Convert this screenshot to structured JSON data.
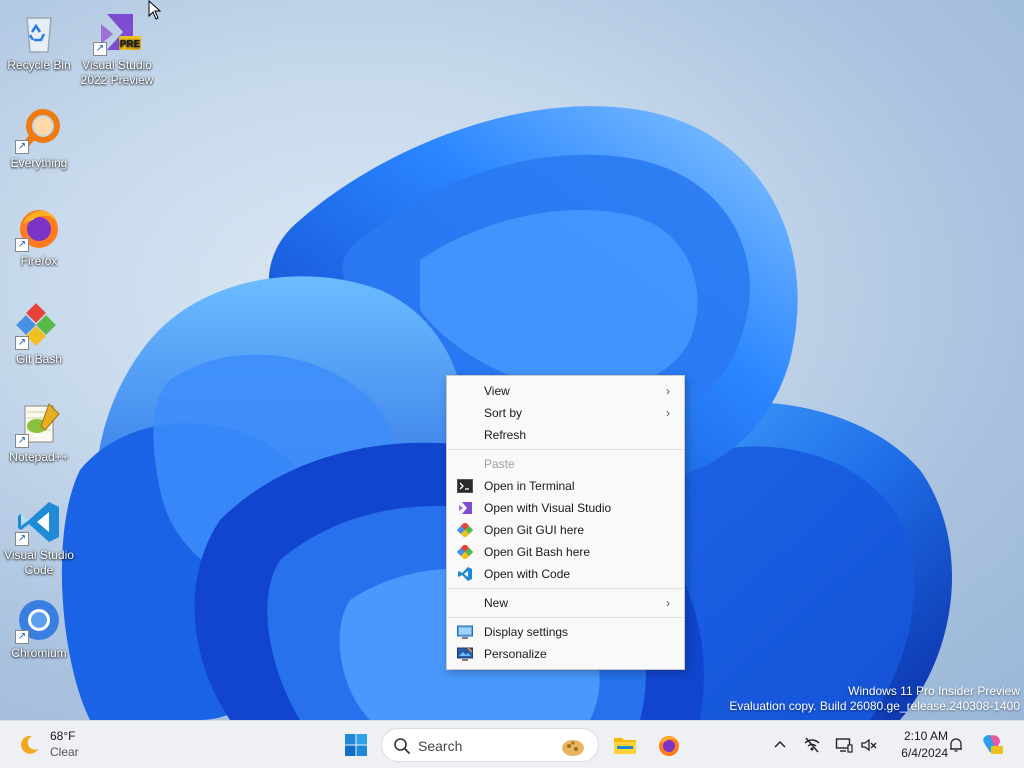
{
  "desktop": {
    "icons": [
      {
        "label": "Recycle Bin",
        "icon": "recycle-bin-icon"
      },
      {
        "label": "Visual Studio 2022 Preview",
        "icon": "visual-studio-preview-icon",
        "badge": "PRE"
      },
      {
        "label": "Everything",
        "icon": "everything-search-icon"
      },
      {
        "label": "Firefox",
        "icon": "firefox-icon"
      },
      {
        "label": "Git Bash",
        "icon": "git-bash-icon"
      },
      {
        "label": "Notepad++",
        "icon": "notepad-plus-plus-icon"
      },
      {
        "label": "Visual Studio Code",
        "icon": "vscode-icon"
      },
      {
        "label": "Chromium",
        "icon": "chromium-icon"
      }
    ]
  },
  "context_menu": {
    "items": [
      {
        "label": "View",
        "submenu": true
      },
      {
        "label": "Sort by",
        "submenu": true
      },
      {
        "label": "Refresh"
      },
      {
        "label": "Paste",
        "disabled": true
      },
      {
        "label": "Open in Terminal",
        "icon": "terminal-icon"
      },
      {
        "label": "Open with Visual Studio",
        "icon": "visual-studio-icon"
      },
      {
        "label": "Open Git GUI here",
        "icon": "git-gui-icon"
      },
      {
        "label": "Open Git Bash here",
        "icon": "git-bash-icon"
      },
      {
        "label": "Open with Code",
        "icon": "vscode-icon"
      },
      {
        "label": "New",
        "submenu": true
      },
      {
        "label": "Display settings",
        "icon": "display-settings-icon"
      },
      {
        "label": "Personalize",
        "icon": "personalize-icon"
      }
    ],
    "submenu_glyph": "›"
  },
  "watermark": {
    "line1": "Windows 11 Pro Insider Preview",
    "line2": "Evaluation copy. Build 26080.ge_release.240308-1400"
  },
  "taskbar": {
    "weather": {
      "temp": "68°F",
      "condition": "Clear",
      "icon": "moon-weather-icon"
    },
    "search": {
      "placeholder": "Search"
    },
    "pinned": [
      "start-icon",
      "file-explorer-icon",
      "firefox-icon"
    ],
    "tray": [
      "chevron-up-icon",
      "network-offline-icon",
      "display-icon",
      "volume-muted-icon"
    ],
    "clock": {
      "time": "2:10 AM",
      "date": "6/4/2024"
    }
  },
  "colors": {
    "accent": "#0067c0",
    "taskbar": "#eef0f4",
    "menu_bg": "#f9f9f9",
    "bloom_blue": "#1f6fe8"
  }
}
